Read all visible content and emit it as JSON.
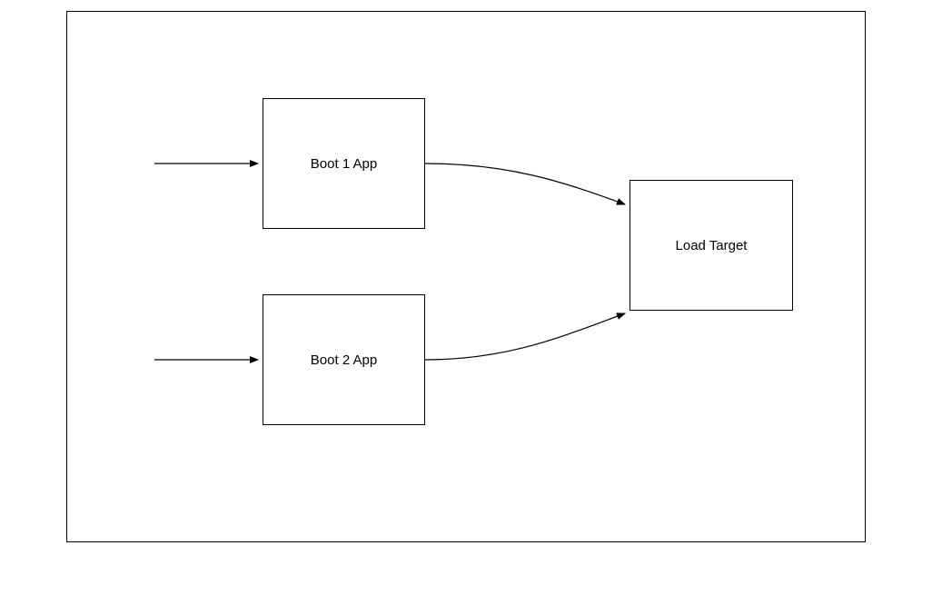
{
  "nodes": {
    "boot1": {
      "label": "Boot 1 App"
    },
    "boot2": {
      "label": "Boot 2 App"
    },
    "target": {
      "label": "Load Target"
    }
  }
}
